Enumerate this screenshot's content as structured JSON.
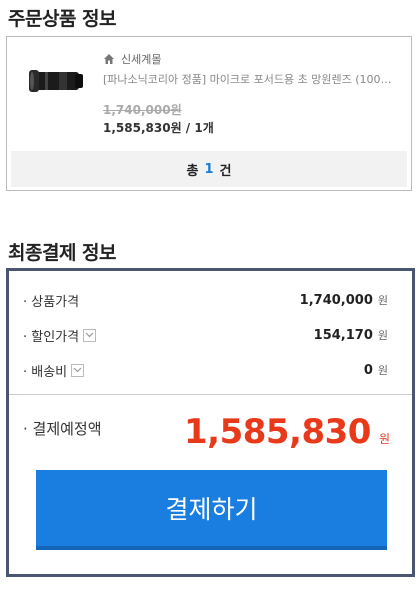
{
  "order_section": {
    "title": "주문상품 정보",
    "seller": "신세계몰",
    "product_name": "[파나소닉코리아 정품] 마이크로 포서드용 초 망원렌즈 (100-400mm)",
    "original_price": "1,740,000",
    "original_unit": "원",
    "sale_price_line": "1,585,830원 / 1개",
    "count_prefix": "총",
    "count_value": "1",
    "count_suffix": "건"
  },
  "payment_section": {
    "title": "최종결제 정보",
    "rows": [
      {
        "label": "· 상품가격",
        "value": "1,740,000",
        "unit": "원"
      },
      {
        "label": "· 할인가격",
        "value": "154,170",
        "unit": "원"
      },
      {
        "label": "· 배송비",
        "value": "0",
        "unit": "원"
      }
    ],
    "total_label": "· 결제예정액",
    "total_value": "1,585,830",
    "total_unit": "원",
    "pay_button_label": "결제하기"
  },
  "colors": {
    "accent_blue": "#1a7de0",
    "total_red": "#e8391a",
    "box_border": "#4a5670"
  }
}
